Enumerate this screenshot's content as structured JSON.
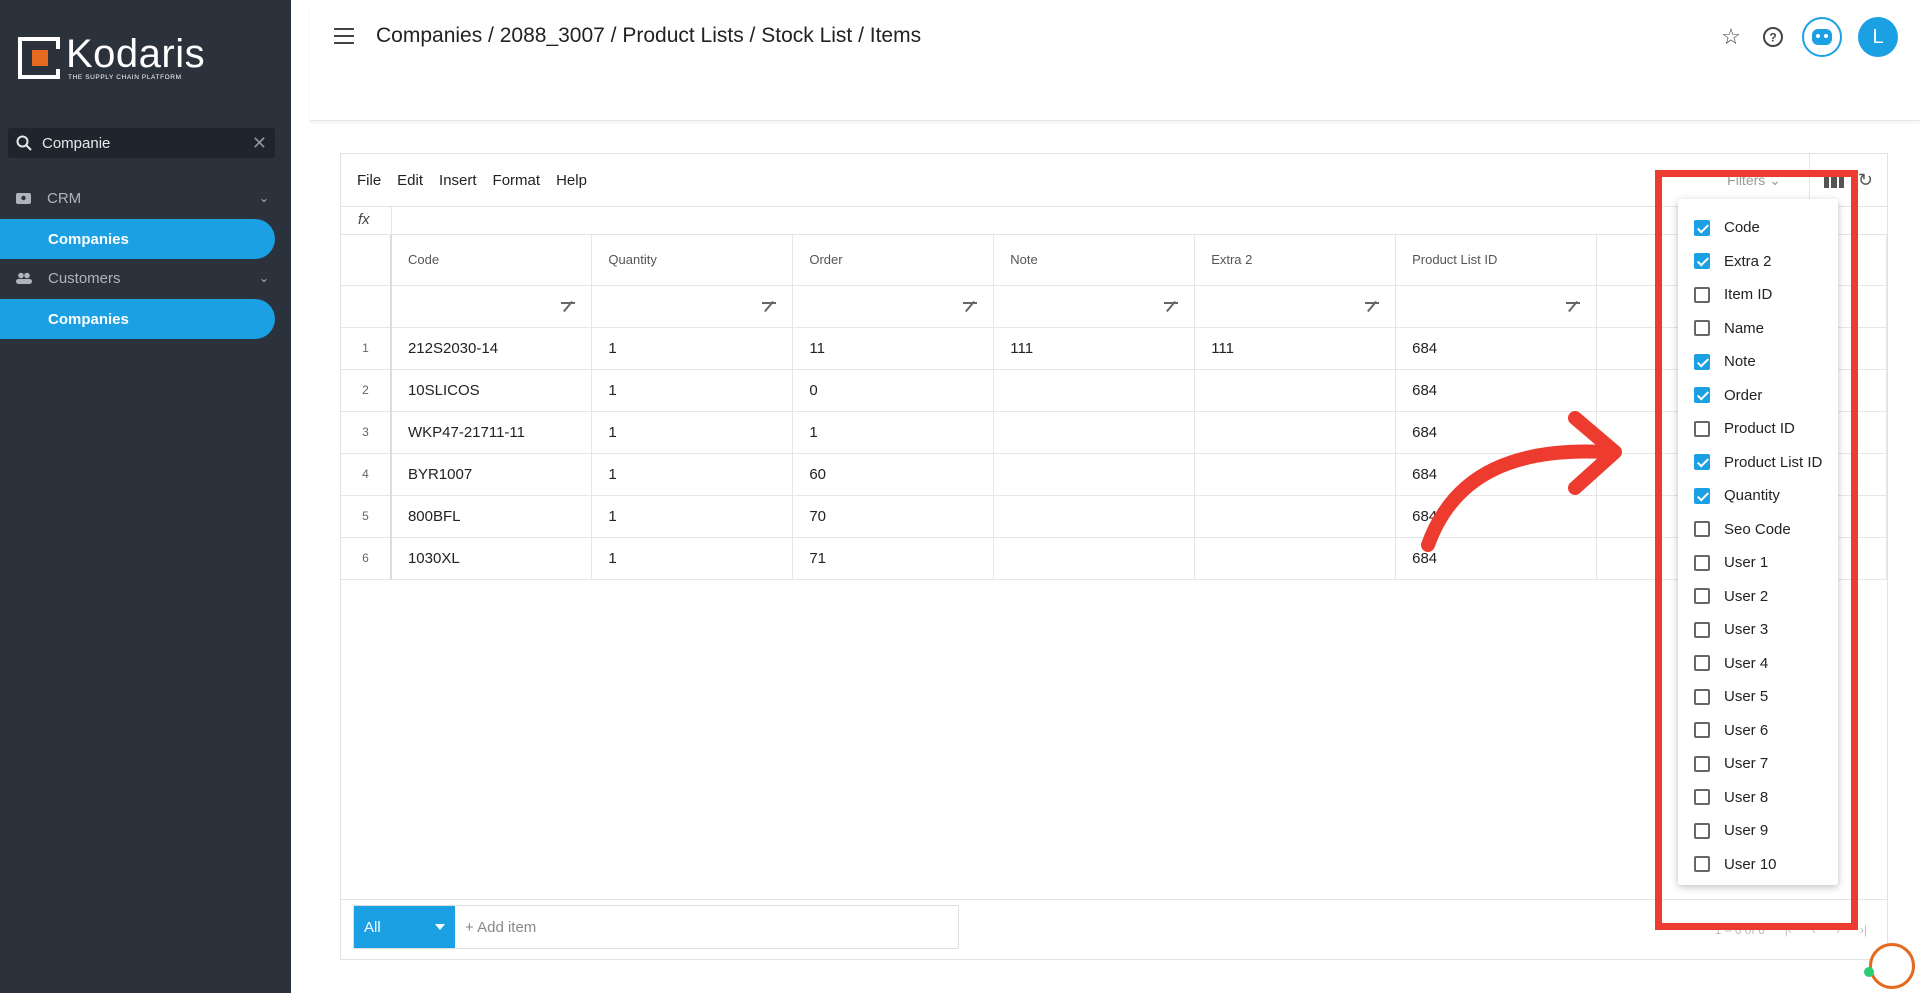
{
  "brand": {
    "name": "Kodaris",
    "tagline": "THE SUPPLY CHAIN PLATFORM"
  },
  "sidebar": {
    "search_value": "Companie",
    "sections": [
      {
        "label": "CRM",
        "icon": "contact-card-icon",
        "item": "Companies"
      },
      {
        "label": "Customers",
        "icon": "people-icon",
        "item": "Companies"
      }
    ]
  },
  "header": {
    "breadcrumb": "Companies / 2088_3007 / Product Lists / Stock List / Items",
    "avatar_letter": "L"
  },
  "menu": [
    "File",
    "Edit",
    "Insert",
    "Format",
    "Help"
  ],
  "toolbar": {
    "filters_label": "Filters",
    "fx_label": "fx"
  },
  "grid": {
    "columns": [
      "Code",
      "Quantity",
      "Order",
      "Note",
      "Extra 2",
      "Product List ID"
    ],
    "rows": [
      {
        "n": "1",
        "cells": [
          "212S2030-14",
          "1",
          "11",
          "111",
          "111",
          "684"
        ]
      },
      {
        "n": "2",
        "cells": [
          "10SLICOS",
          "1",
          "0",
          "",
          "",
          "684"
        ]
      },
      {
        "n": "3",
        "cells": [
          "WKP47-21711-11",
          "1",
          "1",
          "",
          "",
          "684"
        ]
      },
      {
        "n": "4",
        "cells": [
          "BYR1007",
          "1",
          "60",
          "",
          "",
          "684"
        ]
      },
      {
        "n": "5",
        "cells": [
          "800BFL",
          "1",
          "70",
          "",
          "",
          "684"
        ]
      },
      {
        "n": "6",
        "cells": [
          "1030XL",
          "1",
          "71",
          "",
          "",
          "684"
        ]
      }
    ]
  },
  "footer": {
    "filter_select": "All",
    "add_item_placeholder": "+ Add item",
    "pager_text": "1 – 6 of 6"
  },
  "column_menu": [
    {
      "label": "Code",
      "checked": true
    },
    {
      "label": "Extra 2",
      "checked": true
    },
    {
      "label": "Item ID",
      "checked": false
    },
    {
      "label": "Name",
      "checked": false
    },
    {
      "label": "Note",
      "checked": true
    },
    {
      "label": "Order",
      "checked": true
    },
    {
      "label": "Product ID",
      "checked": false
    },
    {
      "label": "Product List ID",
      "checked": true
    },
    {
      "label": "Quantity",
      "checked": true
    },
    {
      "label": "Seo Code",
      "checked": false
    },
    {
      "label": "User 1",
      "checked": false
    },
    {
      "label": "User 2",
      "checked": false
    },
    {
      "label": "User 3",
      "checked": false
    },
    {
      "label": "User 4",
      "checked": false
    },
    {
      "label": "User 5",
      "checked": false
    },
    {
      "label": "User 6",
      "checked": false
    },
    {
      "label": "User 7",
      "checked": false
    },
    {
      "label": "User 8",
      "checked": false
    },
    {
      "label": "User 9",
      "checked": false
    },
    {
      "label": "User 10",
      "checked": false
    }
  ],
  "colors": {
    "accent": "#1aa0e3",
    "sidebar_bg": "#2b323b",
    "annotation_red": "#ee3b2f",
    "brand_orange": "#e56a1f"
  }
}
